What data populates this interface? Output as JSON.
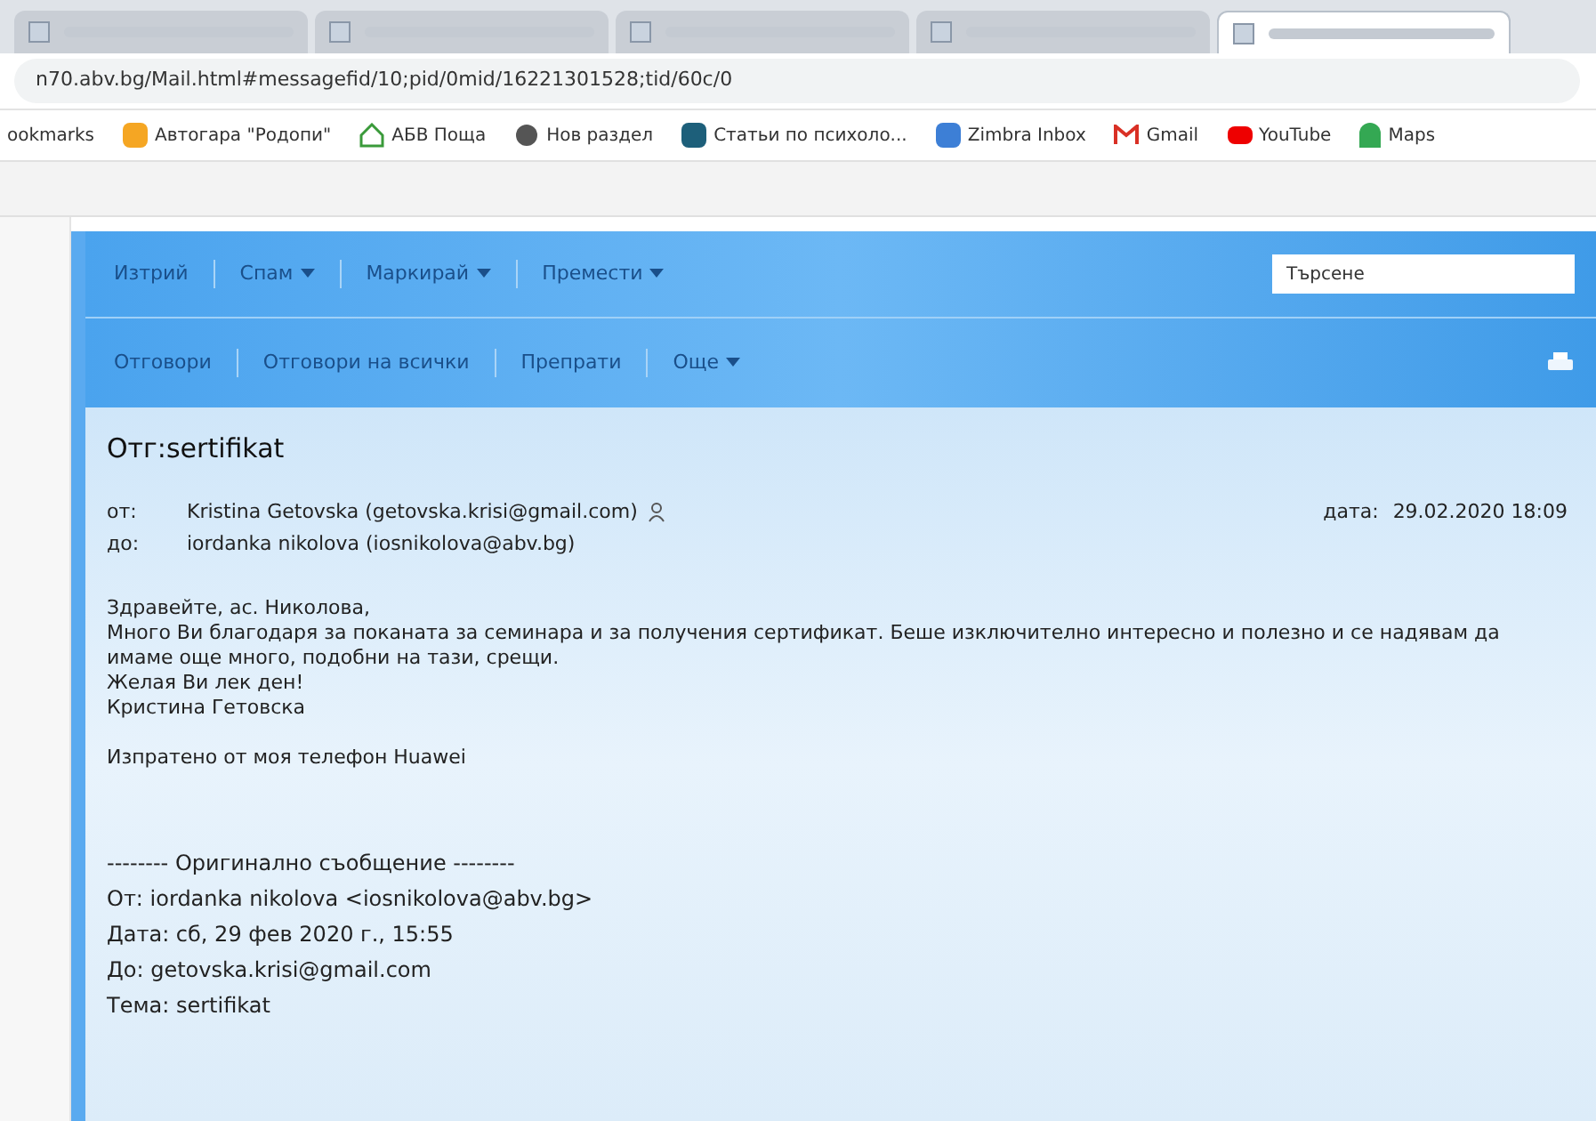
{
  "browser": {
    "tabs": [
      {
        "selected": false
      },
      {
        "selected": false
      },
      {
        "selected": false
      },
      {
        "selected": false
      },
      {
        "selected": true
      }
    ],
    "url": "n70.abv.bg/Mail.html#messagefid/10;pid/0mid/16221301528;tid/60c/0",
    "bookmarks": [
      {
        "label": "ookmarks",
        "kind": "text"
      },
      {
        "label": "Автогара \"Родопи\"",
        "kind": "bus"
      },
      {
        "label": "АБВ Поща",
        "kind": "home"
      },
      {
        "label": "Нов раздел",
        "kind": "globe"
      },
      {
        "label": "Статьи по психоло...",
        "kind": "check"
      },
      {
        "label": "Zimbra Inbox",
        "kind": "zimbra"
      },
      {
        "label": "Gmail",
        "kind": "gmail"
      },
      {
        "label": "YouTube",
        "kind": "youtube"
      },
      {
        "label": "Maps",
        "kind": "maps"
      }
    ]
  },
  "toolbar_1": [
    {
      "label": "Изтрий",
      "dropdown": false
    },
    {
      "label": "Спам",
      "dropdown": true
    },
    {
      "label": "Маркирай",
      "dropdown": true
    },
    {
      "label": "Премести",
      "dropdown": true
    }
  ],
  "search": {
    "placeholder": "Търсене"
  },
  "toolbar_2": [
    {
      "label": "Отговори",
      "dropdown": false
    },
    {
      "label": "Отговори на всички",
      "dropdown": false
    },
    {
      "label": "Препрати",
      "dropdown": false
    },
    {
      "label": "Още",
      "dropdown": true
    }
  ],
  "message": {
    "subject": "Отг:sertifikat",
    "from_label": "от:",
    "from": "Kristina Getovska (getovska.krisi@gmail.com)",
    "to_label": "до:",
    "to": "iordanka nikolova (iosnikolova@abv.bg)",
    "date_label": "дата:",
    "date": "29.02.2020 18:09",
    "body": [
      "Здравейте, ас. Николова,",
      "Много Ви благодаря за поканата за семинара и за получения сертификат. Беше изключително интересно и полезно и се надявам да имаме още много, подобни на тази, срещи.",
      "Желая Ви лек ден!",
      "Кристина Гетовска",
      "Изпратено от моя телефон Huawei"
    ],
    "quoted": [
      "-------- Оригинално съобщение --------",
      "От: iordanka nikolova <iosnikolova@abv.bg>",
      "Дата: сб, 29 фев 2020 г., 15:55",
      "До: getovska.krisi@gmail.com",
      "Тема: sertifikat"
    ]
  }
}
